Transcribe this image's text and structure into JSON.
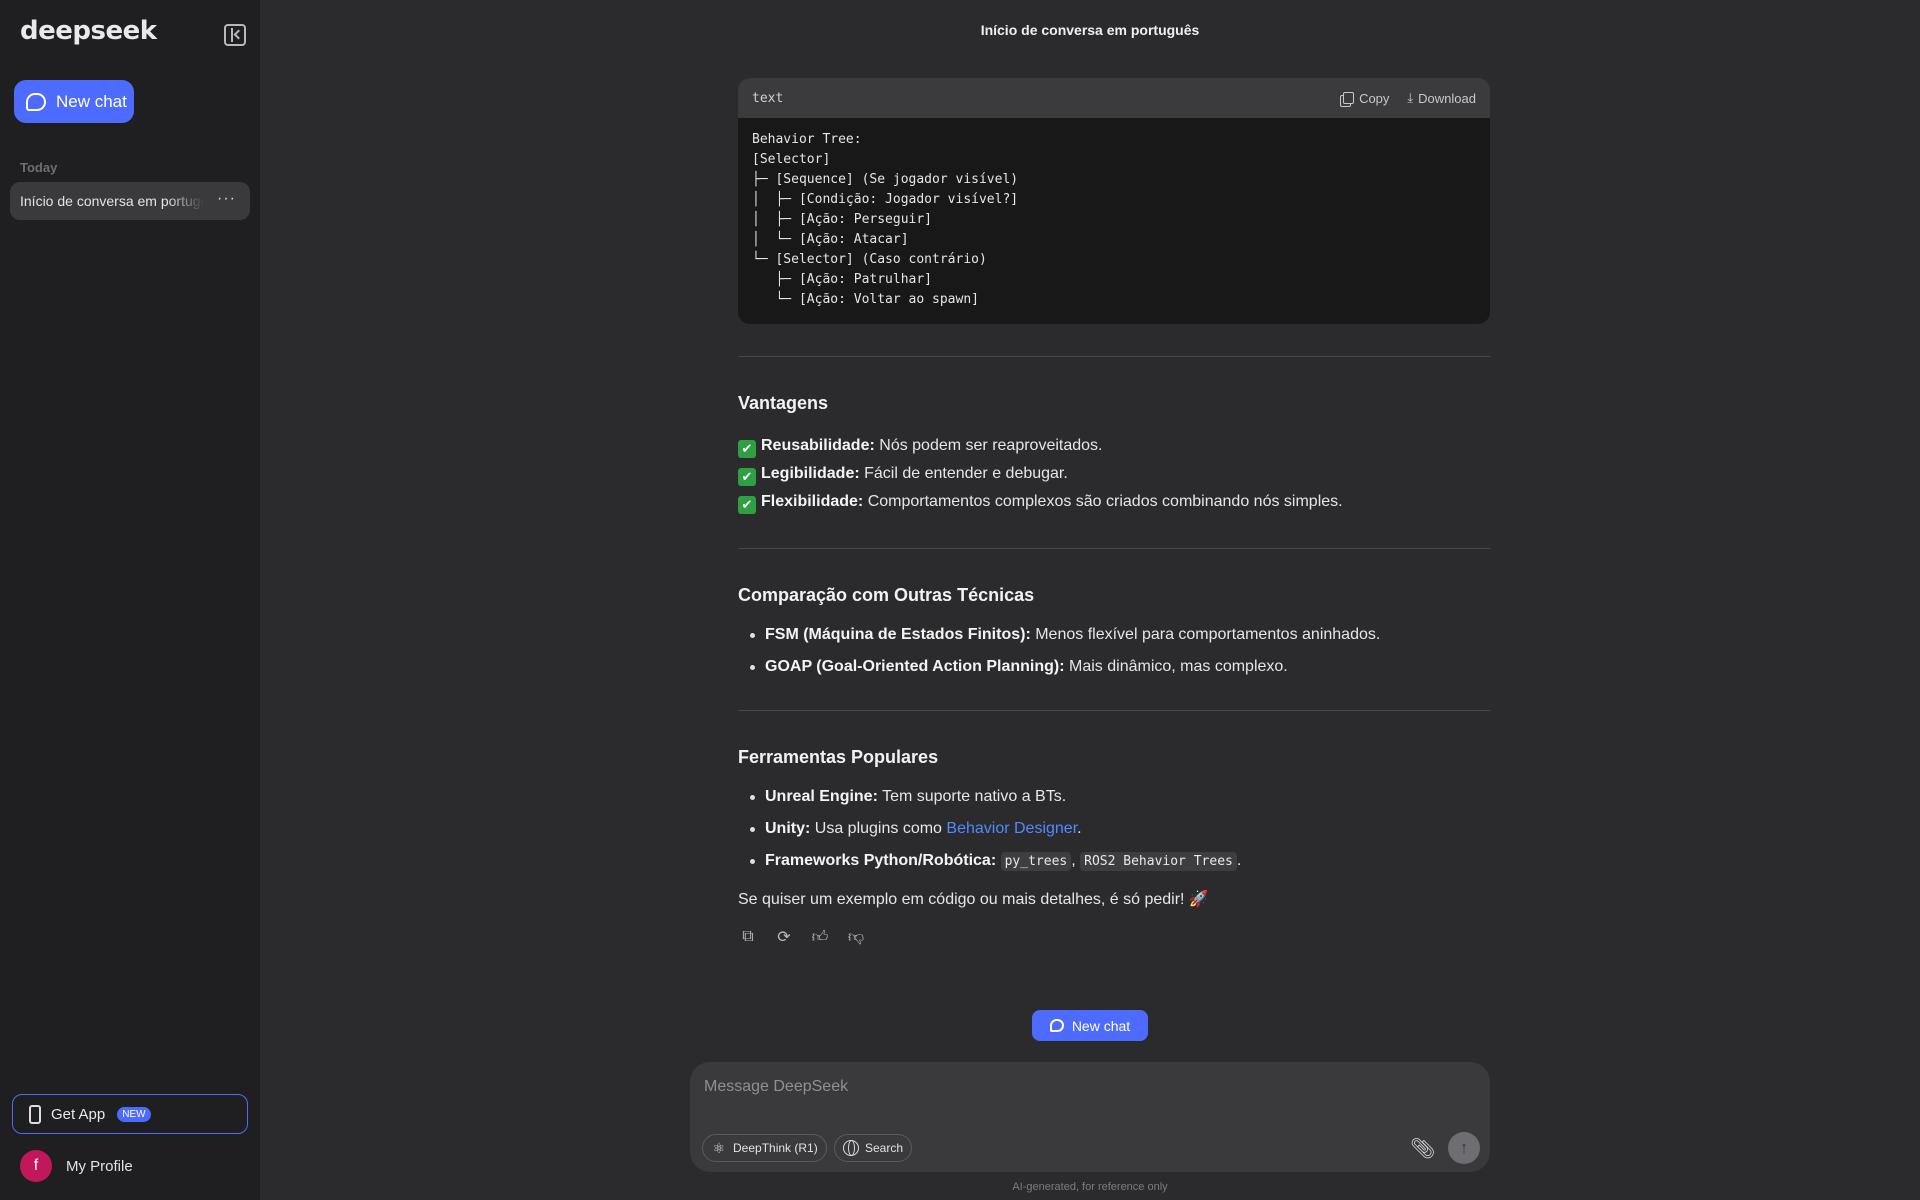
{
  "sidebar": {
    "logo": "deepseek",
    "new_chat_label": "New chat",
    "section_today": "Today",
    "history": [
      {
        "title": "Início de conversa em português",
        "more": "···"
      }
    ],
    "get_app_label": "Get App",
    "get_app_badge": "NEW",
    "profile_initial": "f",
    "profile_label": "My Profile"
  },
  "header": {
    "title": "Início de conversa em português"
  },
  "code_block": {
    "language": "text",
    "copy_label": "Copy",
    "download_label": "Download",
    "content": "Behavior Tree:\n[Selector]\n├─ [Sequence] (Se jogador visível)\n│  ├─ [Condição: Jogador visível?]\n│  ├─ [Ação: Perseguir]\n│  └─ [Ação: Atacar]\n└─ [Selector] (Caso contrário)\n   ├─ [Ação: Patrulhar]\n   └─ [Ação: Voltar ao spawn]"
  },
  "vantagens": {
    "heading": "Vantagens",
    "items": [
      {
        "icon": "✔",
        "bold": "Reusabilidade:",
        "text": " Nós podem ser reaproveitados."
      },
      {
        "icon": "✔",
        "bold": "Legibilidade:",
        "text": " Fácil de entender e debugar."
      },
      {
        "icon": "✔",
        "bold": "Flexibilidade:",
        "text": " Comportamentos complexos são criados combinando nós simples."
      }
    ]
  },
  "comparacao": {
    "heading": "Comparação com Outras Técnicas",
    "items": [
      {
        "bold": "FSM (Máquina de Estados Finitos):",
        "text": " Menos flexível para comportamentos aninhados."
      },
      {
        "bold": "GOAP (Goal-Oriented Action Planning):",
        "text": " Mais dinâmico, mas complexo."
      }
    ]
  },
  "ferramentas": {
    "heading": "Ferramentas Populares",
    "unreal_bold": "Unreal Engine:",
    "unreal_text": " Tem suporte nativo a BTs.",
    "unity_bold": "Unity:",
    "unity_text": " Usa plugins como ",
    "unity_link": "Behavior Designer",
    "unity_end": ".",
    "frameworks_bold": "Frameworks Python/Robótica:",
    "code1": "py_trees",
    "comma": ",",
    "code2": "ROS2 Behavior Trees",
    "end": "."
  },
  "closing": "Se quiser um exemplo em código ou mais detalhes, é só pedir! 🚀",
  "message_actions": {
    "copy_icon": "copy-icon",
    "regenerate_icon": "regenerate-icon",
    "like_icon": "thumbs-up-icon",
    "dislike_icon": "thumbs-down-icon"
  },
  "new_chat_pill": "New chat",
  "composer": {
    "placeholder": "Message DeepSeek",
    "deepthink_label": "DeepThink (R1)",
    "search_label": "Search"
  },
  "footer_note": "AI-generated, for reference only",
  "colors": {
    "accent": "#4d6bfe",
    "background": "#2b2b2d",
    "sidebar": "#1f1f21"
  }
}
